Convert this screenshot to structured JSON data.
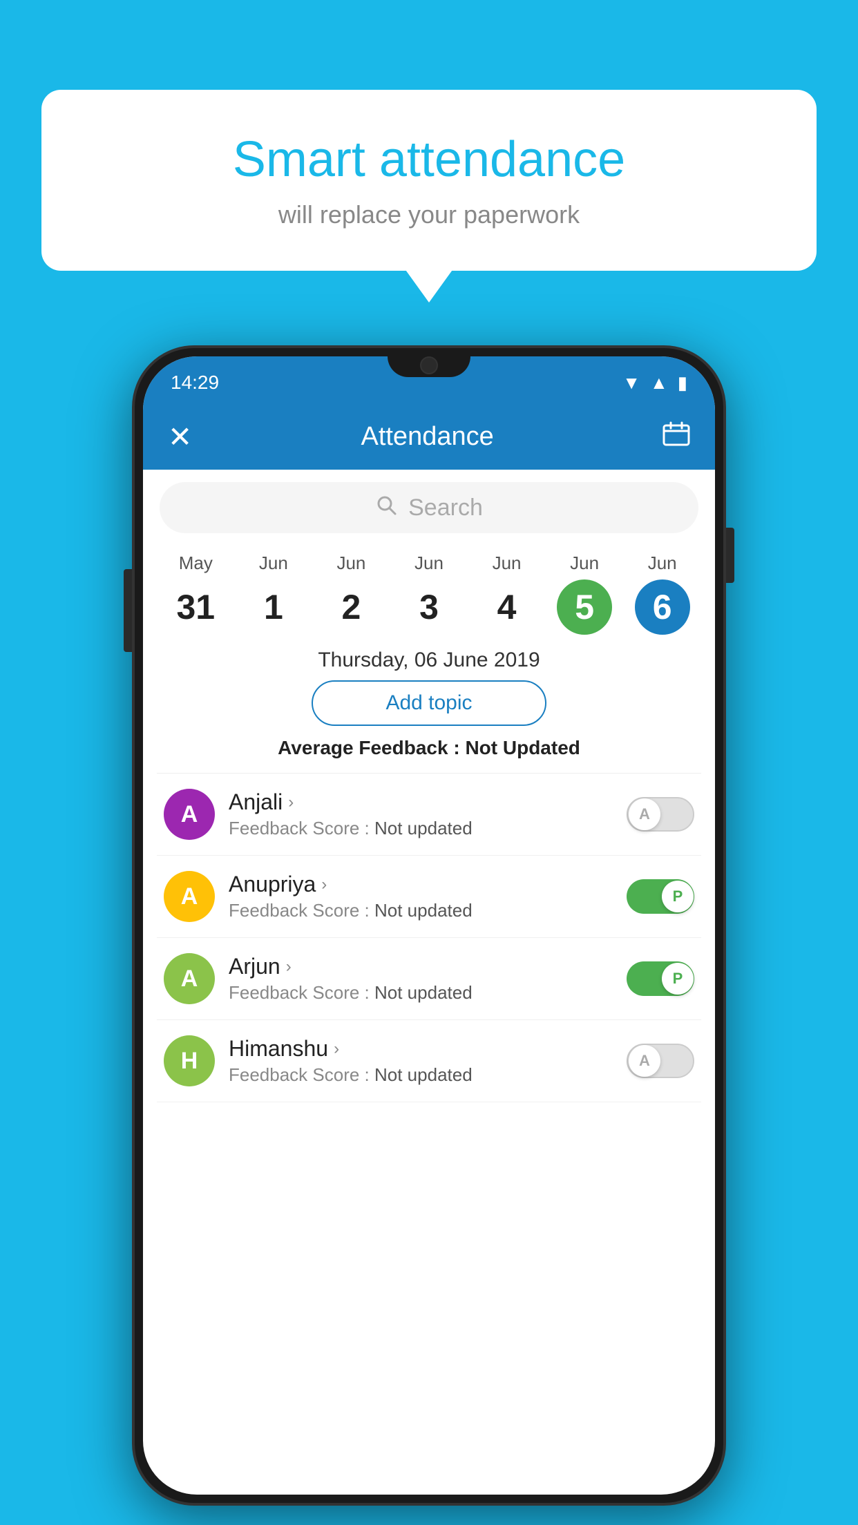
{
  "background": "#1ab8e8",
  "bubble": {
    "title": "Smart attendance",
    "subtitle": "will replace your paperwork"
  },
  "phone": {
    "statusBar": {
      "time": "14:29",
      "icons": [
        "wifi",
        "signal",
        "battery"
      ]
    },
    "header": {
      "title": "Attendance",
      "closeIcon": "×",
      "calendarIcon": "📅"
    },
    "search": {
      "placeholder": "Search"
    },
    "dates": [
      {
        "month": "May",
        "day": "31",
        "state": "normal"
      },
      {
        "month": "Jun",
        "day": "1",
        "state": "normal"
      },
      {
        "month": "Jun",
        "day": "2",
        "state": "normal"
      },
      {
        "month": "Jun",
        "day": "3",
        "state": "normal"
      },
      {
        "month": "Jun",
        "day": "4",
        "state": "normal"
      },
      {
        "month": "Jun",
        "day": "5",
        "state": "today"
      },
      {
        "month": "Jun",
        "day": "6",
        "state": "selected"
      }
    ],
    "selectedDate": "Thursday, 06 June 2019",
    "addTopicLabel": "Add topic",
    "avgFeedback": {
      "label": "Average Feedback : ",
      "value": "Not Updated"
    },
    "students": [
      {
        "name": "Anjali",
        "avatarLetter": "A",
        "avatarColor": "purple",
        "feedbackScore": "Feedback Score : Not updated",
        "toggleState": "off",
        "toggleLabel": "A"
      },
      {
        "name": "Anupriya",
        "avatarLetter": "A",
        "avatarColor": "yellow",
        "feedbackScore": "Feedback Score : Not updated",
        "toggleState": "on",
        "toggleLabel": "P"
      },
      {
        "name": "Arjun",
        "avatarLetter": "A",
        "avatarColor": "green",
        "feedbackScore": "Feedback Score : Not updated",
        "toggleState": "on",
        "toggleLabel": "P"
      },
      {
        "name": "Himanshu",
        "avatarLetter": "H",
        "avatarColor": "lime",
        "feedbackScore": "Feedback Score : Not updated",
        "toggleState": "off",
        "toggleLabel": "A"
      }
    ]
  }
}
